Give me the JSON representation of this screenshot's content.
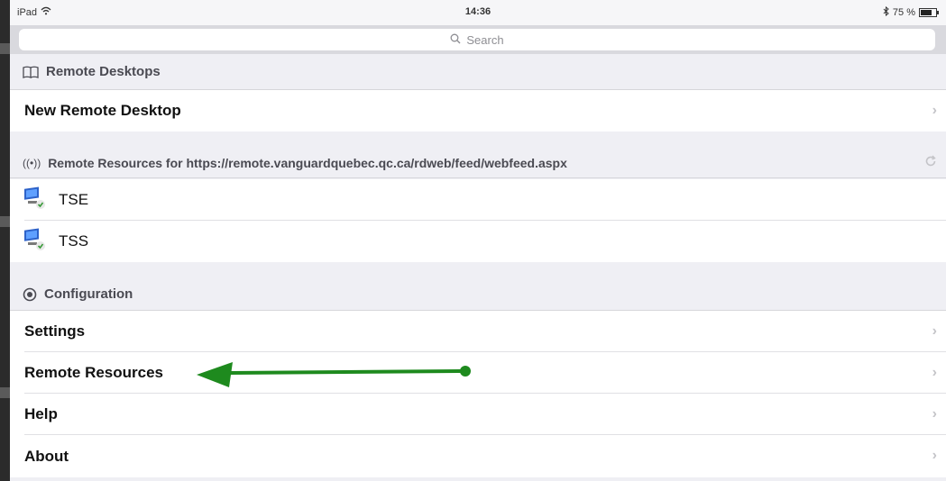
{
  "status_bar": {
    "device": "iPad",
    "time": "14:36",
    "battery_text": "75 %",
    "battery_level": 0.75
  },
  "search": {
    "placeholder": "Search"
  },
  "sections": {
    "remote_desktops": {
      "title": "Remote Desktops",
      "rows": [
        {
          "label": "New Remote Desktop"
        }
      ]
    },
    "remote_resources": {
      "title": "Remote Resources for https://remote.vanguardquebec.qc.ca/rdweb/feed/webfeed.aspx",
      "items": [
        {
          "label": "TSE"
        },
        {
          "label": "TSS"
        }
      ]
    },
    "configuration": {
      "title": "Configuration",
      "rows": [
        {
          "label": "Settings"
        },
        {
          "label": "Remote Resources"
        },
        {
          "label": "Help"
        },
        {
          "label": "About"
        }
      ]
    }
  },
  "colors": {
    "annotation_arrow": "#1e8a1e",
    "section_background": "#efeff4",
    "chevron": "#c4c4c8"
  },
  "icons": {
    "section_remote_desktops": "book-icon",
    "section_remote_resources": "broadcast-icon",
    "section_configuration": "gear-icon",
    "resource_item": "remote-app-icon",
    "row_disclosure": "chevron-right-icon",
    "refresh": "refresh-icon"
  }
}
